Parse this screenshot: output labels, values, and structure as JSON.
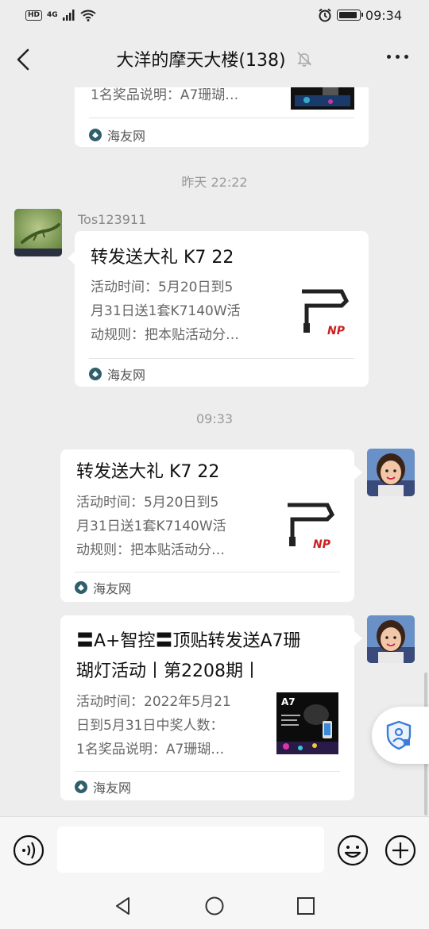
{
  "status_bar": {
    "hd": "HD",
    "network": "4G",
    "time": "09:34"
  },
  "nav": {
    "title": "大洋的摩天大楼(138)"
  },
  "messages": {
    "top_partial": {
      "desc_last_line": "1名奖品说明：A7珊瑚…",
      "source": "海友网"
    },
    "time_1": "昨天 22:22",
    "msg_1": {
      "sender": "Tos123911",
      "title": "转发送大礼 K7 22",
      "desc": [
        "活动时间：5月20日到5",
        "月31日送1套K7140W活",
        "动规则：把本贴活动分…"
      ],
      "thumb_brand": "NP",
      "source": "海友网"
    },
    "time_2": "09:33",
    "msg_2": {
      "title": "转发送大礼 K7 22",
      "desc": [
        "活动时间：5月20日到5",
        "月31日送1套K7140W活",
        "动规则：把本贴活动分…"
      ],
      "thumb_brand": "NP",
      "source": "海友网"
    },
    "msg_3": {
      "title": [
        "〓A+智控〓顶贴转发送A7珊",
        "瑚灯活动丨第2208期丨"
      ],
      "desc": [
        "活动时间：2022年5月21",
        "日到5月31日中奖人数：",
        "1名奖品说明：A7珊瑚…"
      ],
      "thumb_label": "A7",
      "source": "海友网"
    }
  },
  "input": {
    "placeholder": ""
  },
  "icons": {
    "back": "back-arrow-icon",
    "mute": "bell-muted-icon",
    "more": "more-dots-icon",
    "voice": "voice-icon",
    "emoji": "emoji-icon",
    "plus": "plus-icon",
    "shield": "shield-user-icon"
  },
  "colors": {
    "background": "#ededed",
    "card": "#ffffff",
    "shield_accent": "#3b7dd8"
  }
}
